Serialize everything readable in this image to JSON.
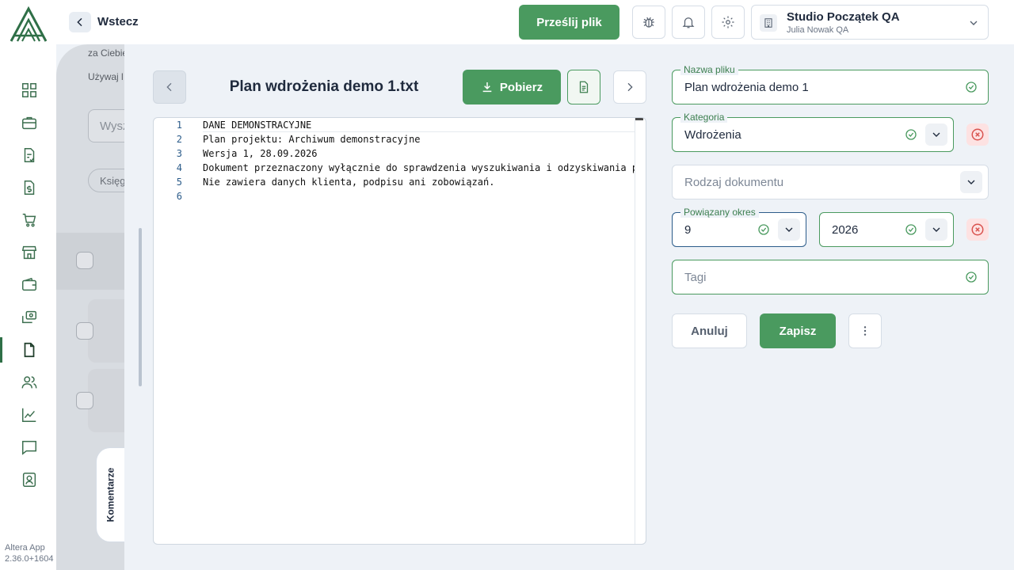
{
  "app": {
    "name": "Altera App",
    "version": "2.36.0+1604",
    "logo_icon": "altera-logo-icon"
  },
  "sidebar": {
    "active_index": 9,
    "items": [
      {
        "icon": "dashboard-grid-icon"
      },
      {
        "icon": "briefcase-icon"
      },
      {
        "icon": "document-check-icon"
      },
      {
        "icon": "invoice-dollar-icon"
      },
      {
        "icon": "shopping-cart-icon"
      },
      {
        "icon": "store-icon"
      },
      {
        "icon": "wallet-icon"
      },
      {
        "icon": "money-transfer-icon"
      },
      {
        "icon": "file-icon"
      },
      {
        "icon": "users-icon"
      },
      {
        "icon": "chart-line-icon"
      },
      {
        "icon": "chat-icon"
      },
      {
        "icon": "contact-card-icon"
      }
    ]
  },
  "header": {
    "back_label": "Wstecz",
    "upload_label": "Prześlij plik",
    "organization_name": "Studio Początek QA",
    "organization_user": "Julia Nowak QA"
  },
  "background_page": {
    "text1": "za Ciebie",
    "text2": "Używaj l",
    "search_placeholder": "Wysz",
    "chip_label": "Księg"
  },
  "viewer": {
    "file_title": "Plan wdrożenia demo 1.txt",
    "download_label": "Pobierz",
    "comments_tab": "Komentarze",
    "lines": [
      {
        "n": "1",
        "text": "DANE DEMONSTRACYJNE"
      },
      {
        "n": "2",
        "text": "Plan projektu: Archiwum demonstracyjne"
      },
      {
        "n": "3",
        "text": "Wersja 1, 28.09.2026"
      },
      {
        "n": "4",
        "text": "Dokument przeznaczony wyłącznie do sprawdzenia wyszukiwania i odzyskiwania pli"
      },
      {
        "n": "5",
        "text": "Nie zawiera danych klienta, podpisu ani zobowiązań."
      },
      {
        "n": "6",
        "text": ""
      }
    ]
  },
  "form": {
    "file_name": {
      "label": "Nazwa pliku",
      "value": "Plan wdrożenia demo 1"
    },
    "category": {
      "label": "Kategoria",
      "value": "Wdrożenia"
    },
    "document_type": {
      "placeholder": "Rodzaj dokumentu"
    },
    "period": {
      "label": "Powiązany okres",
      "month": "9",
      "year": "2026"
    },
    "tags": {
      "placeholder": "Tagi"
    },
    "cancel_label": "Anuluj",
    "save_label": "Zapisz"
  },
  "colors": {
    "primary": "#4a9a5f",
    "danger": "#d9534f",
    "focus": "#2c5c8a"
  }
}
